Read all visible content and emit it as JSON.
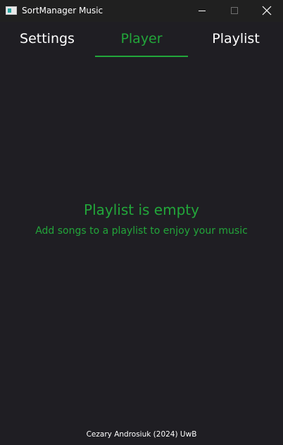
{
  "window": {
    "title": "SortManager Music"
  },
  "titlebar_icons": {
    "app": "app-window-icon",
    "minimize": "minimize-icon",
    "maximize": "maximize-icon",
    "close": "close-icon"
  },
  "tabs": [
    {
      "label": "Settings",
      "selected": false
    },
    {
      "label": "Player",
      "selected": true
    },
    {
      "label": "Playlist",
      "selected": false
    }
  ],
  "empty_state": {
    "title": "Playlist is empty",
    "subtitle": "Add songs to a playlist to enjoy your music"
  },
  "footer": {
    "credit": "Cezary Androsiuk (2024) UwB"
  },
  "colors": {
    "background": "#1f1e23",
    "titlebar": "#202020",
    "accent": "#22a63a",
    "text": "#ffffff"
  }
}
